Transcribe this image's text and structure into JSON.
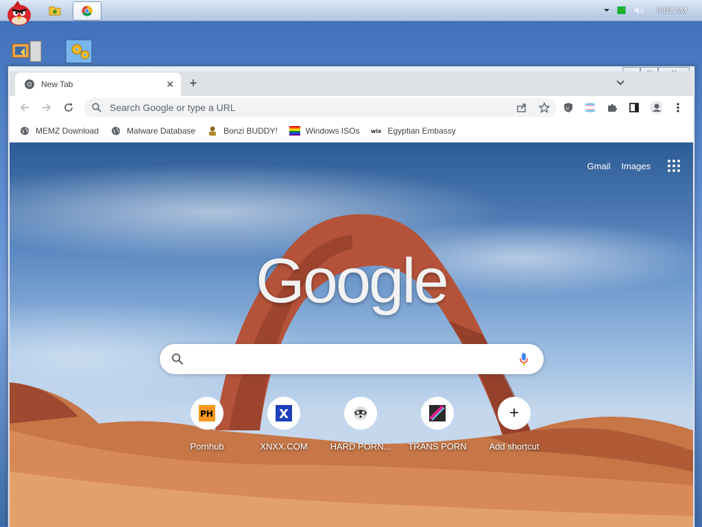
{
  "taskbar": {
    "clock": "6:02 AM",
    "buttons": [
      {
        "icon": "folder-icon"
      },
      {
        "icon": "chrome-icon",
        "active": true
      }
    ],
    "tray": [
      "chevron-up-icon",
      "battery-icon",
      "volume-icon"
    ]
  },
  "desktop_icons": [
    "computer-monitor-icon",
    "control-panel-icon"
  ],
  "browser": {
    "tab": {
      "title": "New Tab",
      "icon": "chrome-icon"
    },
    "omnibox": {
      "placeholder": "Search Google or type a URL"
    },
    "bookmarks": [
      {
        "label": "MEMZ Download",
        "icon": "globe-icon"
      },
      {
        "label": "Malware Database",
        "icon": "globe-icon"
      },
      {
        "label": "Bonzi BUDDY!",
        "icon": "bonzi-icon"
      },
      {
        "label": "Windows ISOs",
        "icon": "windows-flag-icon"
      },
      {
        "label": "Egyptian Embassy",
        "icon": "wix-icon"
      }
    ]
  },
  "newtab": {
    "links": {
      "gmail": "Gmail",
      "images": "Images"
    },
    "logo": "Google",
    "search_placeholder": "",
    "shortcuts": [
      {
        "label": "Pornhub",
        "icon_text": "PH"
      },
      {
        "label": "XNXX.COM",
        "icon_text": "X"
      },
      {
        "label": "HARD PORN...",
        "icon_text": ""
      },
      {
        "label": "TRANS PORN",
        "icon_text": ""
      },
      {
        "label": "Add shortcut",
        "icon_text": "+"
      }
    ]
  },
  "colors": {
    "accent": "#1a73e8",
    "tab_strip": "#dee1e6"
  }
}
